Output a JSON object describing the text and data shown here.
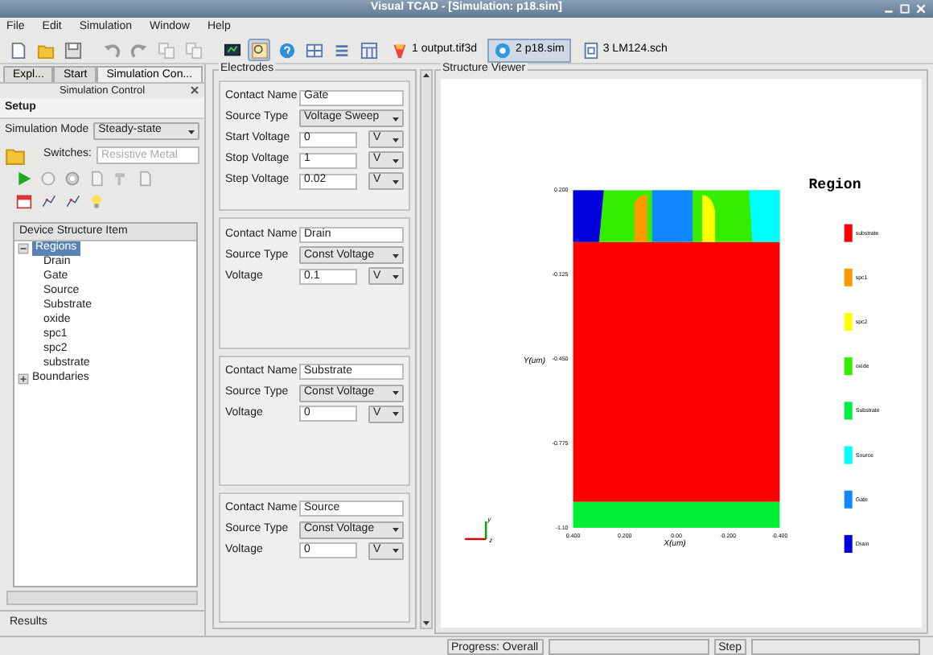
{
  "window": {
    "title": "Visual TCAD - [Simulation: p18.sim]"
  },
  "menu": [
    "File",
    "Edit",
    "Simulation",
    "Window",
    "Help"
  ],
  "documents": [
    {
      "label": "1 output.tif3d",
      "selected": false
    },
    {
      "label": "2 p18.sim",
      "selected": true
    },
    {
      "label": "3 LM124.sch",
      "selected": false
    }
  ],
  "left_panel": {
    "tabs": [
      {
        "label": "Expl...",
        "selected": false
      },
      {
        "label": "Start",
        "selected": false
      },
      {
        "label": "Simulation Con...",
        "selected": true
      }
    ],
    "title": "Simulation Control",
    "section": "Setup",
    "mode_label": "Simulation Mode",
    "mode": "Steady-state",
    "switches_label": "Switches:",
    "switches_placeholder": "Resistive Metal",
    "tree": {
      "header": "Device Structure Item",
      "items": [
        {
          "label": "Regions",
          "expanded": true,
          "selected": true,
          "children": [
            {
              "label": "Drain"
            },
            {
              "label": "Gate"
            },
            {
              "label": "Source"
            },
            {
              "label": "Substrate"
            },
            {
              "label": "oxide"
            },
            {
              "label": "spc1"
            },
            {
              "label": "spc2"
            },
            {
              "label": "substrate"
            }
          ]
        },
        {
          "label": "Boundaries",
          "expanded": false,
          "selected": false
        }
      ]
    },
    "bottom_tab": "Results"
  },
  "electrodes": {
    "title": "Electrodes",
    "items": [
      {
        "contact_label": "Contact Name",
        "contact": "Gate",
        "source_label": "Source Type",
        "source": "Voltage Sweep",
        "fields": [
          {
            "label": "Start Voltage",
            "value": "0",
            "unit": "V"
          },
          {
            "label": "Stop Voltage",
            "value": "1",
            "unit": "V"
          },
          {
            "label": "Step Voltage",
            "value": "0.02",
            "unit": "V"
          }
        ]
      },
      {
        "contact_label": "Contact Name",
        "contact": "Drain",
        "source_label": "Source Type",
        "source": "Const Voltage",
        "fields": [
          {
            "label": "Voltage",
            "value": "0.1",
            "unit": "V"
          }
        ]
      },
      {
        "contact_label": "Contact Name",
        "contact": "Substrate",
        "source_label": "Source Type",
        "source": "Const Voltage",
        "fields": [
          {
            "label": "Voltage",
            "value": "0",
            "unit": "V"
          }
        ]
      },
      {
        "contact_label": "Contact Name",
        "contact": "Source",
        "source_label": "Source Type",
        "source": "Const Voltage",
        "fields": [
          {
            "label": "Voltage",
            "value": "0",
            "unit": "V"
          }
        ]
      }
    ]
  },
  "viewer": {
    "title": "Structure Viewer",
    "legend_title": "Region",
    "legend": [
      {
        "label": "substrate",
        "color": "#ff0000"
      },
      {
        "label": "spc1",
        "color": "#ff9900"
      },
      {
        "label": "spc2",
        "color": "#ffff00"
      },
      {
        "label": "oxide",
        "color": "#33ee00"
      },
      {
        "label": "Substrate",
        "color": "#00ee44"
      },
      {
        "label": "Source",
        "color": "#00ffff"
      },
      {
        "label": "Gate",
        "color": "#1188ff"
      },
      {
        "label": "Drain",
        "color": "#0000dd"
      }
    ],
    "y_axis": "Y(um)",
    "x_axis": "X(um)",
    "yticks": [
      "0.200",
      "-0.125",
      "-0.450",
      "-0.775",
      "-1.10"
    ],
    "xticks": [
      "0.400",
      "0.200",
      "0.00",
      "-0.200",
      "-0.400"
    ],
    "triad": [
      "y",
      "z"
    ]
  },
  "status": {
    "bars": [
      {
        "label": "Progress: Overall"
      },
      {
        "label": "Step"
      }
    ]
  }
}
